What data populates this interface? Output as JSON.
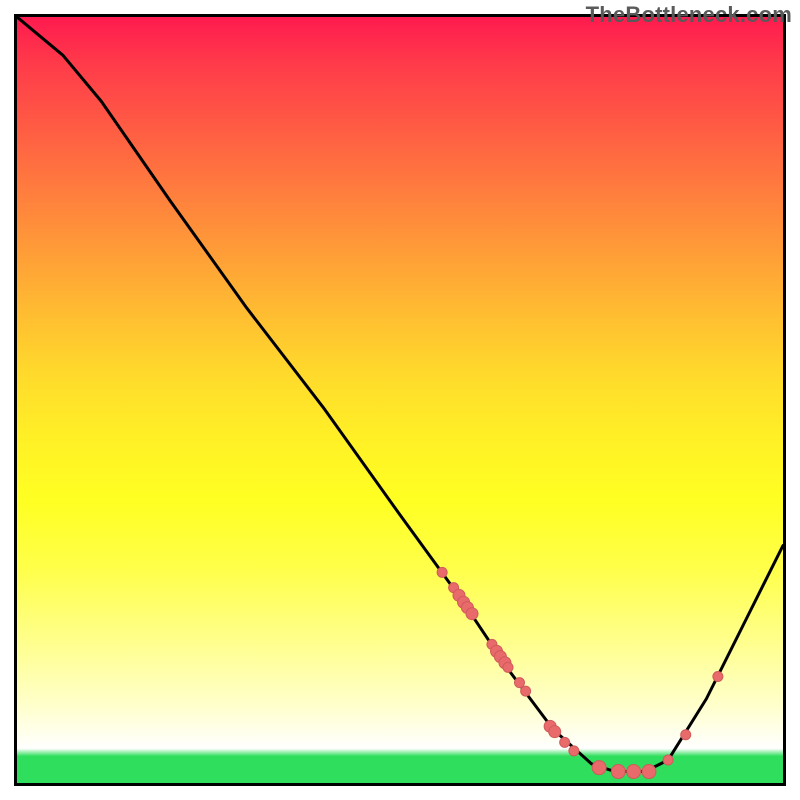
{
  "watermark": "TheBottleneck.com",
  "chart_data": {
    "type": "line",
    "title": "",
    "xlabel": "",
    "ylabel": "",
    "xlim": [
      0,
      100
    ],
    "ylim": [
      0,
      100
    ],
    "grid": false,
    "curve": [
      {
        "x": 0,
        "y": 100
      },
      {
        "x": 6,
        "y": 95
      },
      {
        "x": 11,
        "y": 89
      },
      {
        "x": 20,
        "y": 76
      },
      {
        "x": 30,
        "y": 62
      },
      {
        "x": 40,
        "y": 49
      },
      {
        "x": 50,
        "y": 35
      },
      {
        "x": 58,
        "y": 24
      },
      {
        "x": 64,
        "y": 15
      },
      {
        "x": 70,
        "y": 7
      },
      {
        "x": 75,
        "y": 2.5
      },
      {
        "x": 78,
        "y": 1.5
      },
      {
        "x": 82,
        "y": 1.5
      },
      {
        "x": 85,
        "y": 3
      },
      {
        "x": 90,
        "y": 11
      },
      {
        "x": 95,
        "y": 21
      },
      {
        "x": 100,
        "y": 31
      }
    ],
    "points": [
      {
        "x": 55.5,
        "y": 27.5,
        "r": 5
      },
      {
        "x": 57.0,
        "y": 25.5,
        "r": 5
      },
      {
        "x": 57.7,
        "y": 24.5,
        "r": 6
      },
      {
        "x": 58.3,
        "y": 23.6,
        "r": 6
      },
      {
        "x": 58.8,
        "y": 22.9,
        "r": 6
      },
      {
        "x": 59.4,
        "y": 22.1,
        "r": 6
      },
      {
        "x": 62.0,
        "y": 18.1,
        "r": 5
      },
      {
        "x": 62.6,
        "y": 17.2,
        "r": 6
      },
      {
        "x": 63.1,
        "y": 16.5,
        "r": 6
      },
      {
        "x": 63.7,
        "y": 15.7,
        "r": 6
      },
      {
        "x": 64.1,
        "y": 15.1,
        "r": 5
      },
      {
        "x": 65.6,
        "y": 13.1,
        "r": 5
      },
      {
        "x": 66.4,
        "y": 12.0,
        "r": 5
      },
      {
        "x": 69.6,
        "y": 7.4,
        "r": 6
      },
      {
        "x": 70.2,
        "y": 6.7,
        "r": 6
      },
      {
        "x": 71.5,
        "y": 5.3,
        "r": 5
      },
      {
        "x": 72.7,
        "y": 4.2,
        "r": 5
      },
      {
        "x": 76.0,
        "y": 2.0,
        "r": 7
      },
      {
        "x": 78.5,
        "y": 1.5,
        "r": 7
      },
      {
        "x": 80.5,
        "y": 1.5,
        "r": 7
      },
      {
        "x": 82.5,
        "y": 1.5,
        "r": 7
      },
      {
        "x": 85.0,
        "y": 3.0,
        "r": 5
      },
      {
        "x": 87.3,
        "y": 6.3,
        "r": 5
      },
      {
        "x": 91.5,
        "y": 13.9,
        "r": 5
      }
    ],
    "colors": {
      "top": "#ff1a4f",
      "mid": "#fff026",
      "base": "#2fde5c",
      "curve_stroke": "#000000",
      "point_fill": "#e86a6a",
      "point_stroke": "#d05a5a"
    }
  }
}
